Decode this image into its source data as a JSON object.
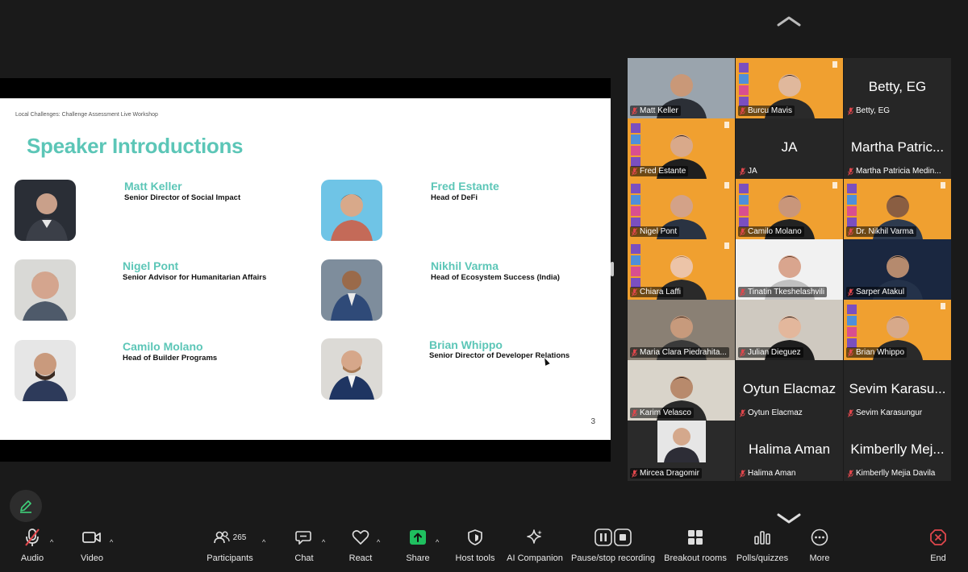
{
  "slide": {
    "header": "Local Challenges: Challenge Assessment Live Workshop",
    "title": "Speaker Introductions",
    "page": "3",
    "speakers": [
      {
        "name": "Matt Keller",
        "role": "Senior Director of Social Impact"
      },
      {
        "name": "Fred Estante",
        "role": "Head of DeFi"
      },
      {
        "name": "Nigel Pont",
        "role": "Senior Advisor for Humanitarian Affairs"
      },
      {
        "name": "Nikhil Varma",
        "role": "Head of Ecosystem Success (India)"
      },
      {
        "name": "Camilo Molano",
        "role": "Head of Builder Programs"
      },
      {
        "name": "Brian Whippo",
        "role": "Senior Director of Developer Relations"
      }
    ]
  },
  "gallery": {
    "tiles": [
      {
        "label": "Matt Keller",
        "type": "video"
      },
      {
        "label": "Burcu Mavis",
        "type": "video"
      },
      {
        "label": "Betty, EG",
        "big": "Betty, EG",
        "type": "name"
      },
      {
        "label": "Fred Estante",
        "type": "video"
      },
      {
        "label": "JA",
        "big": "JA",
        "type": "name"
      },
      {
        "label": "Martha Patricia Medin...",
        "big": "Martha Patric...",
        "type": "name"
      },
      {
        "label": "Nigel Pont",
        "type": "video"
      },
      {
        "label": "Camilo Molano",
        "type": "video"
      },
      {
        "label": "Dr. Nikhil Varma",
        "type": "video"
      },
      {
        "label": "Chiara Laffi",
        "type": "video"
      },
      {
        "label": "Tinatin Tkeshelashvili",
        "type": "video"
      },
      {
        "label": "Sarper Atakul",
        "type": "video"
      },
      {
        "label": "Maria Clara Piedrahita...",
        "type": "video"
      },
      {
        "label": "Julian Dieguez",
        "type": "video"
      },
      {
        "label": "Brian Whippo",
        "type": "video"
      },
      {
        "label": "Karim Velasco",
        "type": "video"
      },
      {
        "label": "Oytun Elacmaz",
        "big": "Oytun Elacmaz",
        "type": "name"
      },
      {
        "label": "Sevim Karasungur",
        "big": "Sevim Karasu...",
        "type": "name"
      },
      {
        "label": "Mircea Dragomir",
        "type": "video"
      },
      {
        "label": "Halima Aman",
        "big": "Halima Aman",
        "type": "name"
      },
      {
        "label": "Kimberlly Mejia Davila",
        "big": "Kimberlly Mej...",
        "type": "name"
      }
    ]
  },
  "toolbar": {
    "audio": "Audio",
    "video": "Video",
    "participants": "Participants",
    "participants_count": "265",
    "chat": "Chat",
    "react": "React",
    "share": "Share",
    "host_tools": "Host tools",
    "ai_companion": "AI Companion",
    "recording": "Pause/stop recording",
    "breakout": "Breakout rooms",
    "polls": "Polls/quizzes",
    "more": "More",
    "end": "End"
  },
  "colors": {
    "accent_teal": "#5cc6b7",
    "share_green": "#1fbf5f",
    "end_red": "#e0474c",
    "tile_orange": "#f0a030"
  }
}
